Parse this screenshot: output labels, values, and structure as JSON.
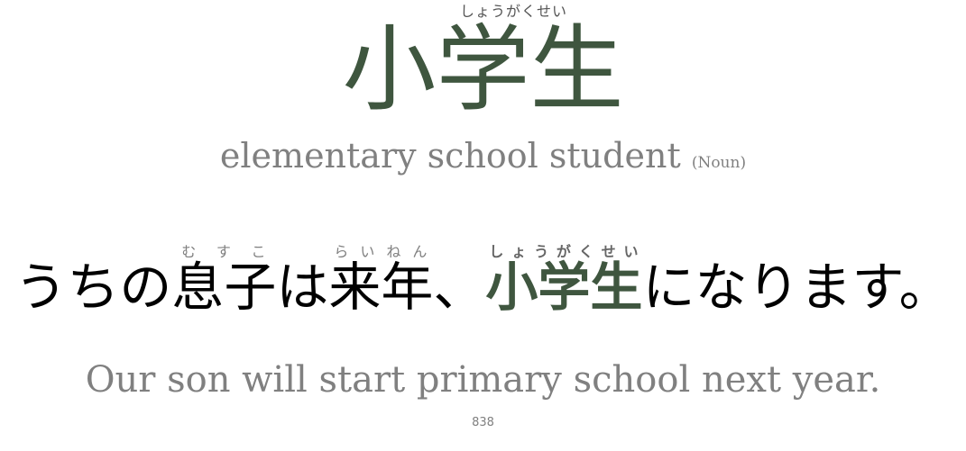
{
  "vocab": {
    "reading": "しょうがくせい",
    "word": "小学生",
    "meaning": "elementary school student",
    "part_of_speech": "(Noun)"
  },
  "sentence": {
    "text_1": "うちの",
    "kanji_1": "息子",
    "reading_1": "むすこ",
    "text_2": "は",
    "kanji_2": "来年",
    "reading_2": "らいねん",
    "text_3": "、",
    "target_kanji": "小学生",
    "target_reading": "しょうがくせい",
    "text_4": "になります。"
  },
  "translation": "Our son will start primary school next year.",
  "card_number": "838",
  "colors": {
    "accent": "#3f563f",
    "muted": "#808080",
    "text": "#000000"
  }
}
